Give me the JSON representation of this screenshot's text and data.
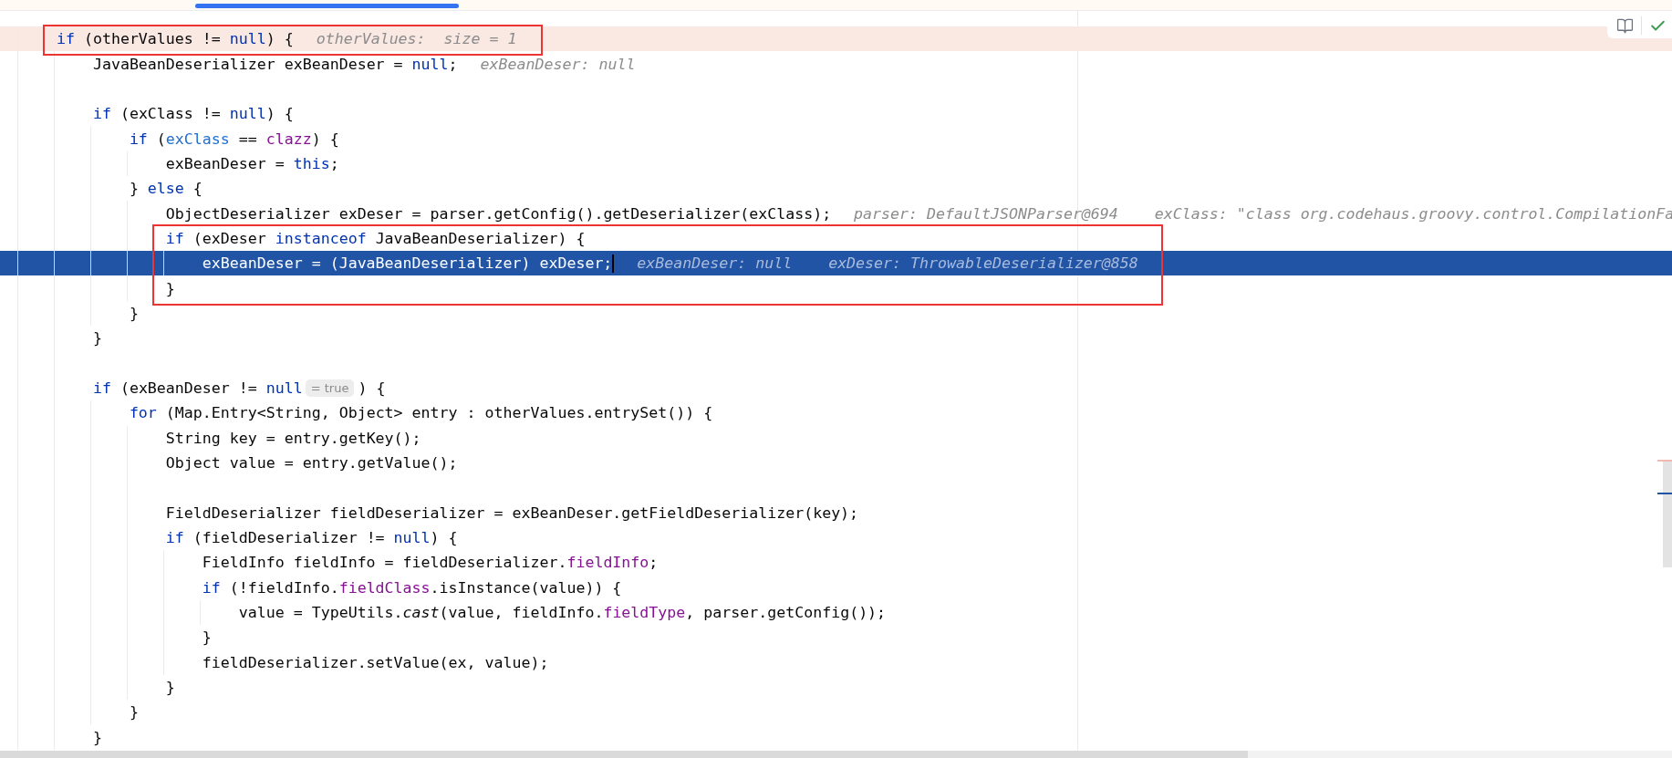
{
  "editor": {
    "lines": [
      {
        "kind": "code",
        "breakpoint": true,
        "boxed": true,
        "segments": [
          {
            "kind": "code",
            "tokens": [
              {
                "text": "if",
                "kind": "keyword"
              },
              {
                "text": " (otherValues != ",
                "kind": "plain"
              },
              {
                "text": "null",
                "kind": "keyword"
              },
              {
                "text": ") {",
                "kind": "plain"
              }
            ]
          },
          {
            "kind": "hint",
            "text": "otherValues:  size = 1"
          }
        ],
        "children": [
          {
            "kind": "code",
            "segments": [
              {
                "kind": "code",
                "tokens": [
                  {
                    "text": "JavaBeanDeserializer exBeanDeser = ",
                    "kind": "plain"
                  },
                  {
                    "text": "null",
                    "kind": "keyword"
                  },
                  {
                    "text": ";",
                    "kind": "plain"
                  }
                ]
              },
              {
                "kind": "hint",
                "text": "exBeanDeser: null"
              }
            ]
          },
          {
            "kind": "blank"
          },
          {
            "kind": "code",
            "segments": [
              {
                "kind": "code",
                "tokens": [
                  {
                    "text": "if",
                    "kind": "keyword"
                  },
                  {
                    "text": " (exClass != ",
                    "kind": "plain"
                  },
                  {
                    "text": "null",
                    "kind": "keyword"
                  },
                  {
                    "text": ") {",
                    "kind": "plain"
                  }
                ]
              }
            ],
            "children": [
              {
                "kind": "code",
                "segments": [
                  {
                    "kind": "code",
                    "tokens": [
                      {
                        "text": "if",
                        "kind": "keyword"
                      },
                      {
                        "text": " (",
                        "kind": "plain"
                      },
                      {
                        "text": "exClass",
                        "kind": "local"
                      },
                      {
                        "text": " == ",
                        "kind": "plain"
                      },
                      {
                        "text": "clazz",
                        "kind": "field"
                      },
                      {
                        "text": ") {",
                        "kind": "plain"
                      }
                    ]
                  }
                ],
                "children": [
                  {
                    "kind": "code",
                    "segments": [
                      {
                        "kind": "code",
                        "tokens": [
                          {
                            "text": "exBeanDeser = ",
                            "kind": "plain"
                          },
                          {
                            "text": "this",
                            "kind": "keyword"
                          },
                          {
                            "text": ";",
                            "kind": "plain"
                          }
                        ]
                      }
                    ]
                  }
                ]
              },
              {
                "kind": "code",
                "segments": [
                  {
                    "kind": "code",
                    "tokens": [
                      {
                        "text": "} ",
                        "kind": "plain"
                      },
                      {
                        "text": "else",
                        "kind": "keyword"
                      },
                      {
                        "text": " {",
                        "kind": "plain"
                      }
                    ]
                  }
                ],
                "children": [
                  {
                    "kind": "code",
                    "segments": [
                      {
                        "kind": "code",
                        "tokens": [
                          {
                            "text": "ObjectDeserializer exDeser = parser.getConfig().getDeserializer(exClass);",
                            "kind": "plain"
                          }
                        ]
                      },
                      {
                        "kind": "hint",
                        "text": "parser: DefaultJSONParser@694"
                      },
                      {
                        "kind": "hint",
                        "text": "exClass: \"class org.codehaus.groovy.control.CompilationFa"
                      }
                    ]
                  },
                  {
                    "kind": "code",
                    "boxed": true,
                    "segments": [
                      {
                        "kind": "code",
                        "tokens": [
                          {
                            "text": "if",
                            "kind": "keyword"
                          },
                          {
                            "text": " (exDeser ",
                            "kind": "plain"
                          },
                          {
                            "text": "instanceof",
                            "kind": "keyword"
                          },
                          {
                            "text": " JavaBeanDeserializer) {",
                            "kind": "plain"
                          }
                        ]
                      }
                    ],
                    "children": [
                      {
                        "kind": "code",
                        "execution_point": true,
                        "boxed": true,
                        "caret": true,
                        "segments": [
                          {
                            "kind": "code",
                            "tokens": [
                              {
                                "text": "exBeanDeser = (JavaBeanDeserializer) exDeser;",
                                "kind": "plain"
                              }
                            ]
                          },
                          {
                            "kind": "hint",
                            "text": "exBeanDeser: null"
                          },
                          {
                            "kind": "hint",
                            "text": "exDeser: ThrowableDeserializer@858"
                          }
                        ]
                      }
                    ]
                  },
                  {
                    "kind": "code",
                    "boxed": true,
                    "segments": [
                      {
                        "kind": "code",
                        "tokens": [
                          {
                            "text": "}",
                            "kind": "plain"
                          }
                        ]
                      }
                    ]
                  }
                ]
              },
              {
                "kind": "code",
                "segments": [
                  {
                    "kind": "code",
                    "tokens": [
                      {
                        "text": "}",
                        "kind": "plain"
                      }
                    ]
                  }
                ]
              }
            ]
          },
          {
            "kind": "code",
            "segments": [
              {
                "kind": "code",
                "tokens": [
                  {
                    "text": "}",
                    "kind": "plain"
                  }
                ]
              }
            ]
          },
          {
            "kind": "blank"
          },
          {
            "kind": "code",
            "segments": [
              {
                "kind": "code",
                "tokens": [
                  {
                    "text": "if",
                    "kind": "keyword"
                  },
                  {
                    "text": " (exBeanDeser != ",
                    "kind": "plain"
                  },
                  {
                    "text": "null",
                    "kind": "keyword"
                  }
                ]
              },
              {
                "kind": "inlay",
                "text": "= true"
              },
              {
                "kind": "code",
                "tokens": [
                  {
                    "text": ") {",
                    "kind": "plain"
                  }
                ]
              }
            ],
            "children": [
              {
                "kind": "code",
                "segments": [
                  {
                    "kind": "code",
                    "tokens": [
                      {
                        "text": "for",
                        "kind": "keyword"
                      },
                      {
                        "text": " (Map.Entry<String, Object> entry : otherValues.entrySet()) {",
                        "kind": "plain"
                      }
                    ]
                  }
                ],
                "children": [
                  {
                    "kind": "code",
                    "segments": [
                      {
                        "kind": "code",
                        "tokens": [
                          {
                            "text": "String key = entry.getKey();",
                            "kind": "plain"
                          }
                        ]
                      }
                    ]
                  },
                  {
                    "kind": "code",
                    "segments": [
                      {
                        "kind": "code",
                        "tokens": [
                          {
                            "text": "Object value = entry.getValue();",
                            "kind": "plain"
                          }
                        ]
                      }
                    ]
                  },
                  {
                    "kind": "blank"
                  },
                  {
                    "kind": "code",
                    "segments": [
                      {
                        "kind": "code",
                        "tokens": [
                          {
                            "text": "FieldDeserializer fieldDeserializer = exBeanDeser.getFieldDeserializer(key);",
                            "kind": "plain"
                          }
                        ]
                      }
                    ]
                  },
                  {
                    "kind": "code",
                    "segments": [
                      {
                        "kind": "code",
                        "tokens": [
                          {
                            "text": "if",
                            "kind": "keyword"
                          },
                          {
                            "text": " (fieldDeserializer != ",
                            "kind": "plain"
                          },
                          {
                            "text": "null",
                            "kind": "keyword"
                          },
                          {
                            "text": ") {",
                            "kind": "plain"
                          }
                        ]
                      }
                    ],
                    "children": [
                      {
                        "kind": "code",
                        "segments": [
                          {
                            "kind": "code",
                            "tokens": [
                              {
                                "text": "FieldInfo fieldInfo = fieldDeserializer.",
                                "kind": "plain"
                              },
                              {
                                "text": "fieldInfo",
                                "kind": "field"
                              },
                              {
                                "text": ";",
                                "kind": "plain"
                              }
                            ]
                          }
                        ]
                      },
                      {
                        "kind": "code",
                        "segments": [
                          {
                            "kind": "code",
                            "tokens": [
                              {
                                "text": "if",
                                "kind": "keyword"
                              },
                              {
                                "text": " (!fieldInfo.",
                                "kind": "plain"
                              },
                              {
                                "text": "fieldClass",
                                "kind": "field"
                              },
                              {
                                "text": ".isInstance(value)) {",
                                "kind": "plain"
                              }
                            ]
                          }
                        ],
                        "children": [
                          {
                            "kind": "code",
                            "segments": [
                              {
                                "kind": "code",
                                "tokens": [
                                  {
                                    "text": "value = TypeUtils.",
                                    "kind": "plain"
                                  },
                                  {
                                    "text": "cast",
                                    "kind": "static_call"
                                  },
                                  {
                                    "text": "(value, fieldInfo.",
                                    "kind": "plain"
                                  },
                                  {
                                    "text": "fieldType",
                                    "kind": "field"
                                  },
                                  {
                                    "text": ", parser.getConfig());",
                                    "kind": "plain"
                                  }
                                ]
                              }
                            ]
                          }
                        ]
                      },
                      {
                        "kind": "code",
                        "segments": [
                          {
                            "kind": "code",
                            "tokens": [
                              {
                                "text": "}",
                                "kind": "plain"
                              }
                            ]
                          }
                        ]
                      },
                      {
                        "kind": "code",
                        "segments": [
                          {
                            "kind": "code",
                            "tokens": [
                              {
                                "text": "fieldDeserializer.setValue(ex, value);",
                                "kind": "plain"
                              }
                            ]
                          }
                        ]
                      }
                    ]
                  },
                  {
                    "kind": "code",
                    "segments": [
                      {
                        "kind": "code",
                        "tokens": [
                          {
                            "text": "}",
                            "kind": "plain"
                          }
                        ]
                      }
                    ]
                  }
                ]
              },
              {
                "kind": "code",
                "segments": [
                  {
                    "kind": "code",
                    "tokens": [
                      {
                        "text": "}",
                        "kind": "plain"
                      }
                    ]
                  }
                ]
              }
            ]
          },
          {
            "kind": "code",
            "segments": [
              {
                "kind": "code",
                "tokens": [
                  {
                    "text": "}",
                    "kind": "plain"
                  }
                ]
              }
            ]
          }
        ]
      }
    ]
  }
}
